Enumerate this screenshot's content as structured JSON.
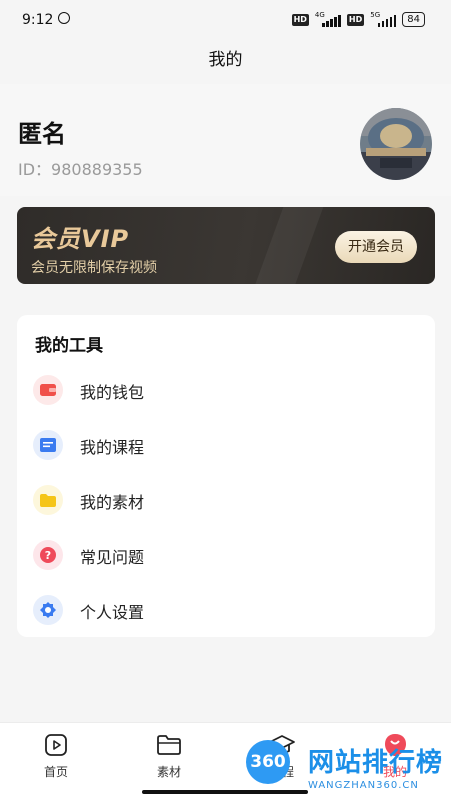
{
  "status_bar": {
    "time": "9:12",
    "hd1": "HD",
    "net1": "4G",
    "hd2": "HD",
    "net2": "5G",
    "battery": "84"
  },
  "header": {
    "title": "我的"
  },
  "profile": {
    "name": "匿名",
    "id_text": "ID：980889355"
  },
  "vip": {
    "title": "会员VIP",
    "subtitle": "会员无限制保存视频",
    "button": "开通会员",
    "accent": "#e9c99a"
  },
  "tools": {
    "title": "我的工具",
    "items": [
      {
        "label": "我的钱包",
        "icon": "wallet-icon",
        "color": "#f0504a"
      },
      {
        "label": "我的课程",
        "icon": "course-icon",
        "color": "#3a7bf0"
      },
      {
        "label": "我的素材",
        "icon": "folder-icon",
        "color": "#f5c518"
      },
      {
        "label": "常见问题",
        "icon": "question-icon",
        "color": "#ef4a5a"
      },
      {
        "label": "个人设置",
        "icon": "settings-icon",
        "color": "#3a7bf0"
      }
    ]
  },
  "tabbar": {
    "items": [
      {
        "label": "首页",
        "icon": "play-icon"
      },
      {
        "label": "素材",
        "icon": "folder-icon"
      },
      {
        "label": "课程",
        "icon": "graduation-cap-icon"
      },
      {
        "label": "我的",
        "icon": "profile-icon"
      }
    ]
  },
  "watermark": {
    "logo": "360",
    "text": "网站排行榜",
    "url": "WANGZHAN360.CN"
  }
}
